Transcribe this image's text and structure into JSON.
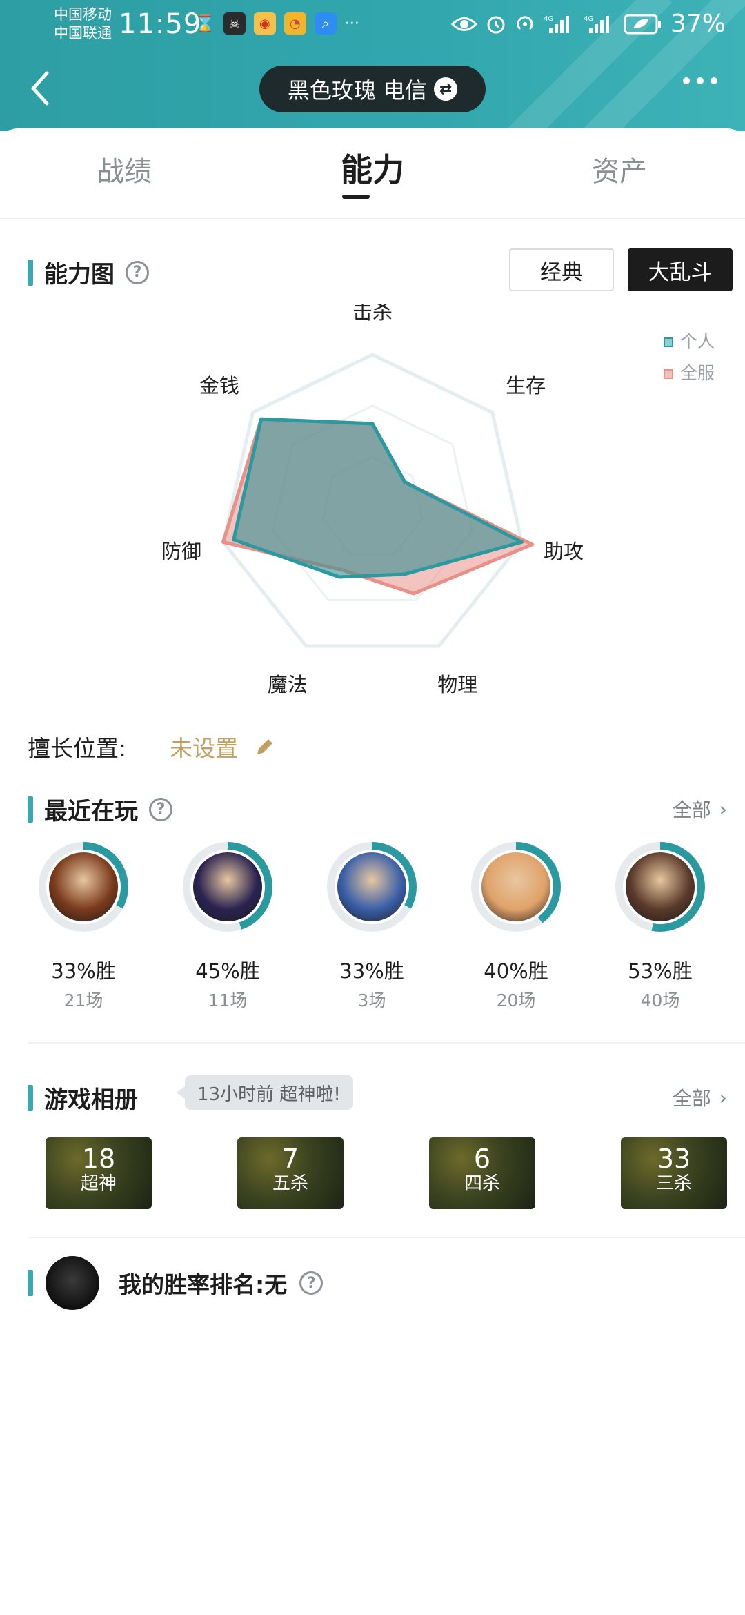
{
  "status_bar": {
    "carrier_1": "中国移动",
    "carrier_2": "中国联通",
    "time": "11:59",
    "battery": "37%",
    "icons": [
      "hourglass-icon",
      "app-icon",
      "weibo-icon",
      "app-icon",
      "search-app-icon",
      "more-icon",
      "eye-icon",
      "alarm-icon",
      "hotspot-icon",
      "signal-icon",
      "signal-icon",
      "battery-icon"
    ]
  },
  "header": {
    "account": "黑色玫瑰 电信",
    "swap_icon": "swap-icon",
    "back_icon": "chevron-left-icon",
    "more_icon": "more-dots-icon"
  },
  "tabs": [
    {
      "label": "战绩",
      "active": false
    },
    {
      "label": "能力",
      "active": true
    },
    {
      "label": "资产",
      "active": false
    }
  ],
  "ability": {
    "title": "能力图",
    "help_icon": "question-icon",
    "mode_classic": "经典",
    "mode_brawl": "大乱斗",
    "selected_mode": "大乱斗",
    "axes": [
      "击杀",
      "生存",
      "助攻",
      "物理",
      "魔法",
      "防御",
      "金钱"
    ],
    "legend_personal": "个人",
    "legend_server": "全服",
    "personal_color": "#2a9aa0",
    "server_color": "#e8918a",
    "personal_values": [
      0.55,
      0.27,
      1.0,
      0.48,
      0.5,
      0.93,
      0.93
    ],
    "server_values": [
      0.55,
      0.27,
      1.07,
      0.62,
      0.45,
      1.0,
      0.93
    ]
  },
  "position": {
    "label": "擅长位置:",
    "value": "未设置",
    "edit_icon": "pencil-icon"
  },
  "recent": {
    "title": "最近在玩",
    "help_icon": "question-icon",
    "all_label": "全部",
    "heroes": [
      {
        "win_rate": "33%胜",
        "games": "21场",
        "ring": 0.33,
        "color": "#7a3a1c"
      },
      {
        "win_rate": "45%胜",
        "games": "11场",
        "ring": 0.45,
        "color": "#2a2350"
      },
      {
        "win_rate": "33%胜",
        "games": "3场",
        "ring": 0.33,
        "color": "#3a5fa8"
      },
      {
        "win_rate": "40%胜",
        "games": "20场",
        "ring": 0.4,
        "color": "#e0a26a"
      },
      {
        "win_rate": "53%胜",
        "games": "40场",
        "ring": 0.53,
        "color": "#5a3a2a"
      }
    ]
  },
  "album": {
    "title": "游戏相册",
    "bubble": "13小时前 超神啦!",
    "all_label": "全部",
    "items": [
      {
        "count": "18",
        "label": "超神"
      },
      {
        "count": "7",
        "label": "五杀"
      },
      {
        "count": "6",
        "label": "四杀"
      },
      {
        "count": "33",
        "label": "三杀"
      }
    ]
  },
  "ranking": {
    "text": "我的胜率排名:无",
    "help_icon": "question-icon"
  }
}
